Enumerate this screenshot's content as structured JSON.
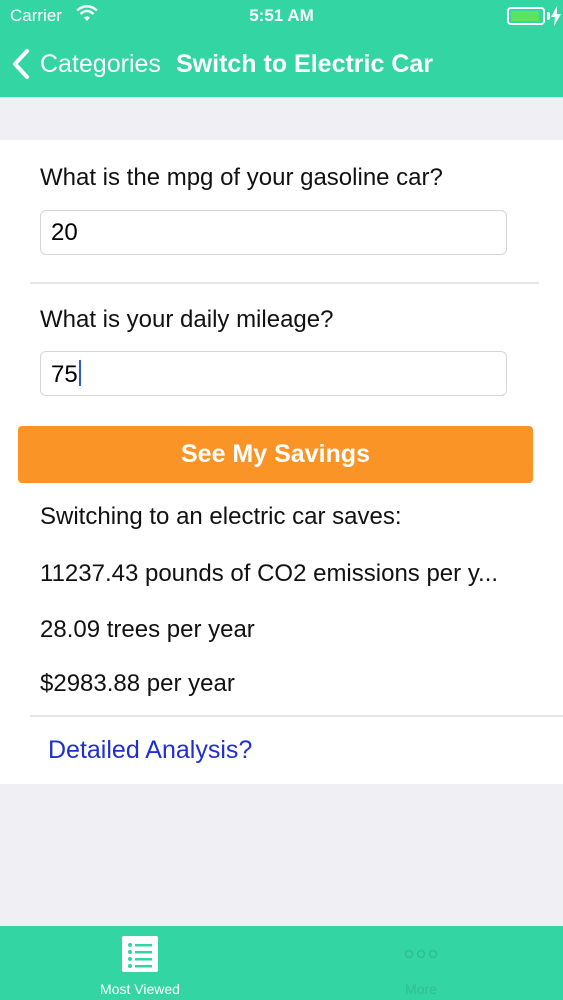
{
  "status_bar": {
    "carrier": "Carrier",
    "time": "5:51 AM",
    "icons": [
      "wifi-icon",
      "battery-icon",
      "charging-icon"
    ]
  },
  "nav": {
    "back_label": "Categories",
    "title": "Switch to Electric Car"
  },
  "form": {
    "mpg_question": "What is the mpg of your gasoline car?",
    "mpg_value": "20",
    "mileage_question": "What is your daily mileage?",
    "mileage_value": "75"
  },
  "button": {
    "label": "See My Savings"
  },
  "results": {
    "heading": "Switching to an electric car saves:",
    "co2": "11237.43 pounds of CO2 emissions per y...",
    "trees": "28.09 trees per year",
    "money": "$2983.88 per year"
  },
  "link": {
    "label": "Detailed Analysis?"
  },
  "tab_bar": {
    "tabs": [
      {
        "label": "Most Viewed",
        "icon": "list-icon"
      },
      {
        "label": "More",
        "icon": "more-icon"
      }
    ]
  },
  "colors": {
    "brand": "#33d6a2",
    "button": "#fa9426",
    "link": "#1f2fd1"
  }
}
